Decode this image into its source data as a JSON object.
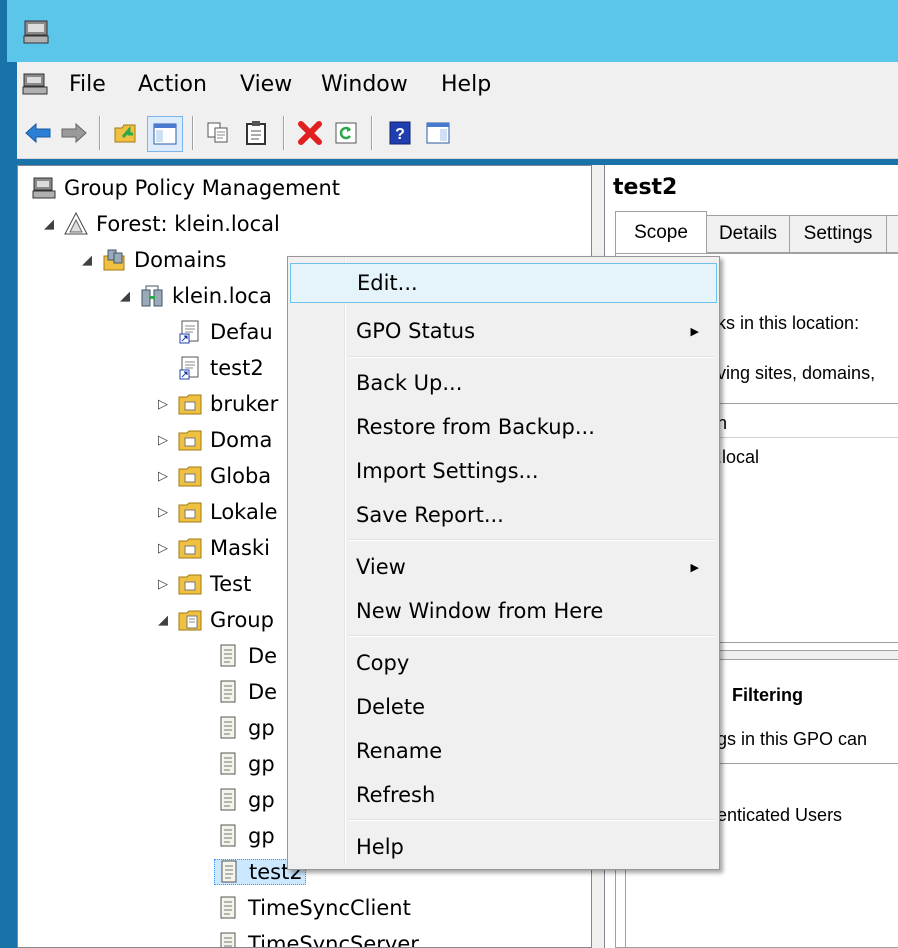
{
  "menubar": {
    "items": [
      "File",
      "Action",
      "View",
      "Window",
      "Help"
    ]
  },
  "toolbar": {
    "icons": [
      "back-arrow-icon",
      "forward-arrow-icon",
      "up-folder-icon",
      "show-hide-tree-icon",
      "copy-icon",
      "paste-icon",
      "delete-icon",
      "refresh-icon",
      "help-icon",
      "action-pane-icon"
    ],
    "colors": {
      "arrow": "#2b7fd6",
      "delete": "#e02020",
      "refresh": "#2aa84a",
      "help": "#1f3fb0"
    }
  },
  "tree": {
    "root": "Group Policy Management",
    "forest": "Forest: klein.local",
    "domains": "Domains",
    "domain": "klein.loca",
    "domain_children": [
      "Defau",
      "test2",
      "bruker",
      "Doma",
      "Globa",
      "Lokale",
      "Maski",
      "Test",
      "Group"
    ],
    "gpos": [
      "De",
      "De",
      "gp",
      "gp",
      "gp",
      "gp",
      "test2",
      "TimeSyncClient",
      "TimeSyncServer"
    ]
  },
  "right": {
    "title": "test2",
    "tabs": [
      "Scope",
      "Details",
      "Settings"
    ],
    "links_text": "ks in this location:",
    "sites_text": "ving sites, domains,",
    "col_header": "n",
    "row_value": ".local",
    "filtering_heading": "Filtering",
    "filtering_text": "gs in this GPO can",
    "auth_users": "enticated Users"
  },
  "context_menu": {
    "items": [
      "Edit...",
      "GPO Status",
      "Back Up...",
      "Restore from Backup...",
      "Import Settings...",
      "Save Report...",
      "View",
      "New Window from Here",
      "Copy",
      "Delete",
      "Rename",
      "Refresh",
      "Help"
    ],
    "highlighted": "Edit..."
  }
}
